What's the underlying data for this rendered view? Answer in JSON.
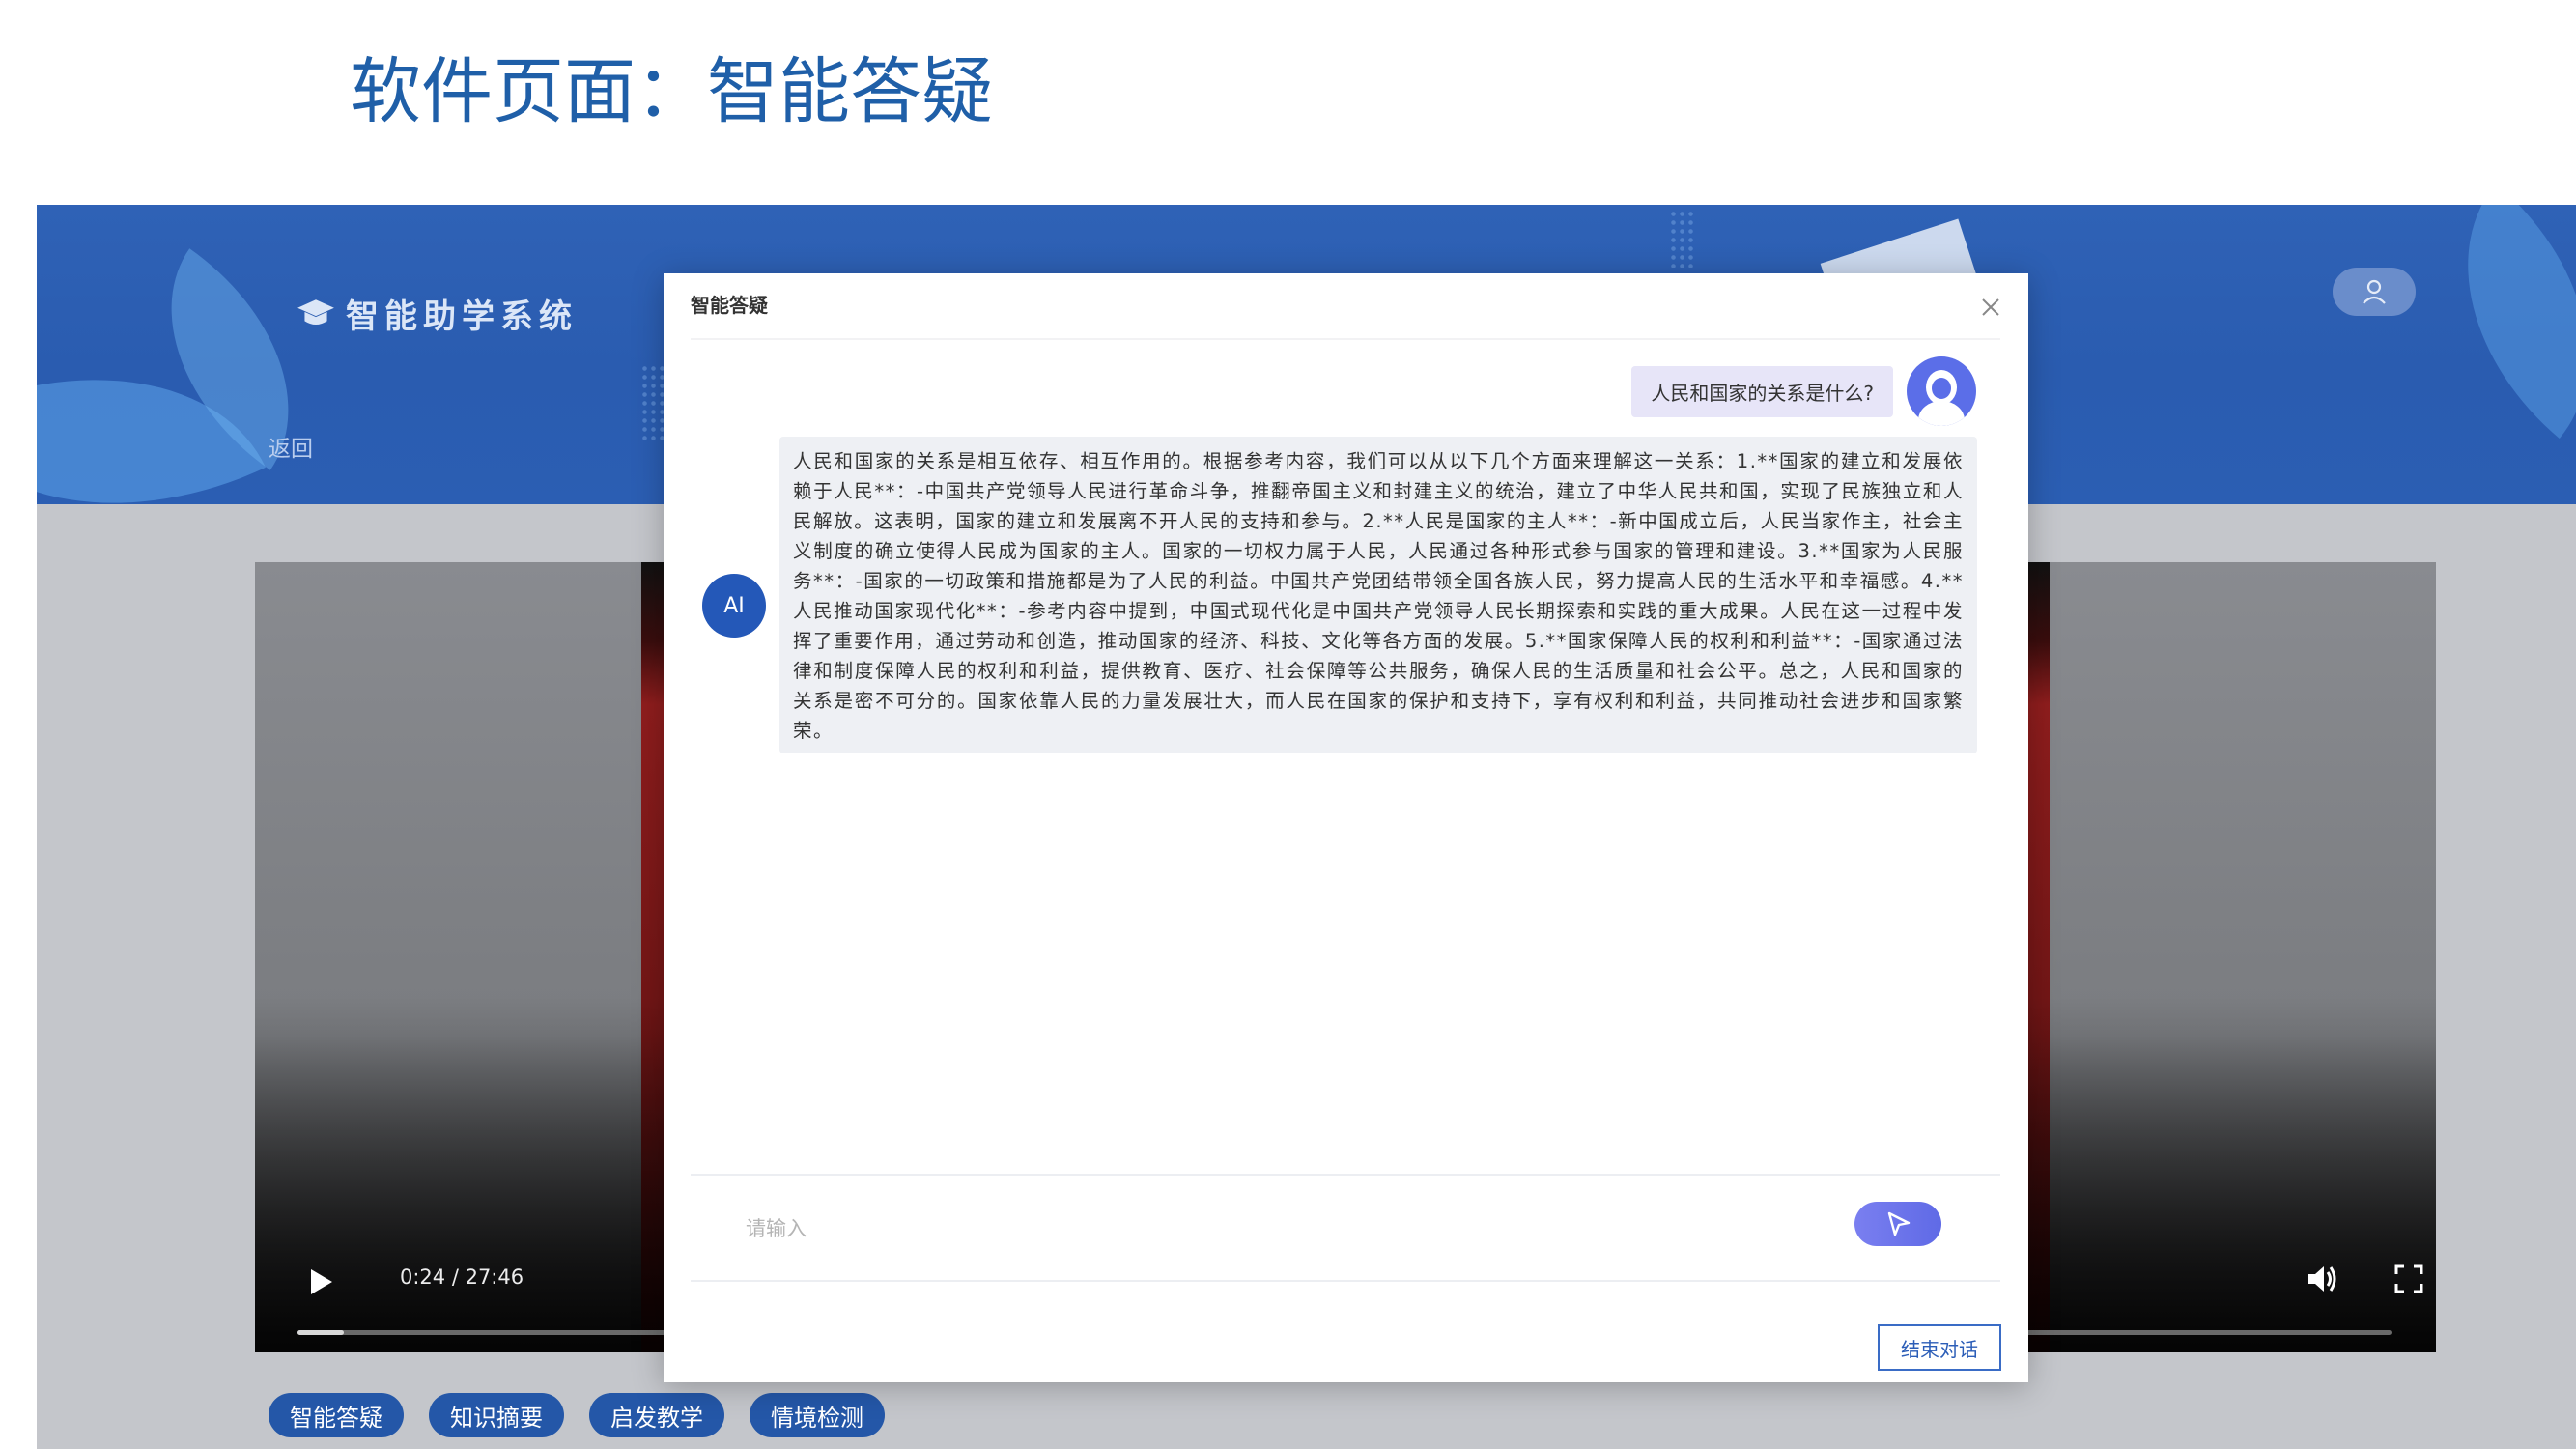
{
  "slide": {
    "title": "软件页面：智能答疑"
  },
  "header": {
    "brand_name": "智能助学系统",
    "back_label": "返回"
  },
  "video": {
    "time": "0:24 / 27:46",
    "progress": 0.0146
  },
  "tabs": [
    {
      "label": "智能答疑"
    },
    {
      "label": "知识摘要"
    },
    {
      "label": "启发教学"
    },
    {
      "label": "情境检测"
    }
  ],
  "dialog": {
    "title": "智能答疑",
    "user_message": "人民和国家的关系是什么?",
    "ai_label": "AI",
    "ai_message": "人民和国家的关系是相互依存、相互作用的。根据参考内容，我们可以从以下几个方面来理解这一关系：1.**国家的建立和发展依赖于人民**：-中国共产党领导人民进行革命斗争，推翻帝国主义和封建主义的统治，建立了中华人民共和国，实现了民族独立和人民解放。这表明，国家的建立和发展离不开人民的支持和参与。2.**人民是国家的主人**：-新中国成立后，人民当家作主，社会主义制度的确立使得人民成为国家的主人。国家的一切权力属于人民，人民通过各种形式参与国家的管理和建设。3.**国家为人民服务**：-国家的一切政策和措施都是为了人民的利益。中国共产党团结带领全国各族人民，努力提高人民的生活水平和幸福感。4.**人民推动国家现代化**：-参考内容中提到，中国式现代化是中国共产党领导人民长期探索和实践的重大成果。人民在这一过程中发挥了重要作用，通过劳动和创造，推动国家的经济、科技、文化等各方面的发展。5.**国家保障人民的权利和利益**：-国家通过法律和制度保障人民的权利和利益，提供教育、医疗、社会保障等公共服务，确保人民的生活质量和社会公平。总之，人民和国家的关系是密不可分的。国家依靠人民的力量发展壮大，而人民在国家的保护和支持下，享有权利和利益，共同推动社会进步和国家繁荣。",
    "input_placeholder": "请输入",
    "end_button": "结束对话"
  },
  "icons": {
    "brand": "graduation-cap-icon",
    "user": "user-icon",
    "close": "close-icon",
    "send": "send-cursor-icon",
    "play": "play-icon",
    "volume": "volume-icon",
    "fullscreen": "fullscreen-icon"
  },
  "colors": {
    "primary": "#2457a8",
    "accent": "#5f6ae6",
    "title": "#1f5fa8"
  }
}
